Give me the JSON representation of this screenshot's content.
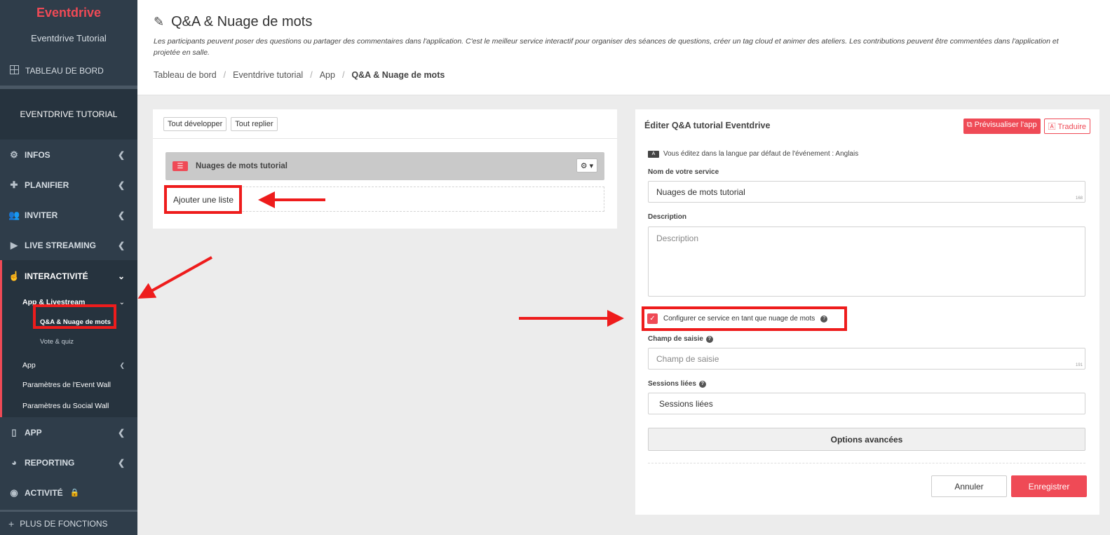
{
  "sidebar": {
    "brand": "Eventdrive",
    "event_name": "Eventdrive Tutorial",
    "dashboard": "TABLEAU DE BORD",
    "sub_brand": "EVENTDRIVE TUTORIAL",
    "items": [
      {
        "label": "INFOS",
        "icon": "gears-icon"
      },
      {
        "label": "PLANIFIER",
        "icon": "puzzle-icon"
      },
      {
        "label": "INVITER",
        "icon": "users-icon"
      },
      {
        "label": "LIVE STREAMING",
        "icon": "play-icon"
      }
    ],
    "interactivity": {
      "label": "INTERACTIVITÉ",
      "app_livestream": "App & Livestream",
      "qa": "Q&A & Nuage de mots",
      "vote": "Vote & quiz",
      "app": "App",
      "event_wall": "Paramètres de l'Event Wall",
      "social_wall": "Paramètres du Social Wall"
    },
    "bottom_items": [
      {
        "label": "APP",
        "icon": "mobile-icon"
      },
      {
        "label": "REPORTING",
        "icon": "pie-chart-icon"
      },
      {
        "label": "ACTIVITÉ",
        "icon": "eye-icon"
      }
    ],
    "more": "PLUS DE FONCTIONS"
  },
  "header": {
    "title": "Q&A & Nuage de mots",
    "description": "Les participants peuvent poser des questions ou partager des commentaires dans l'application. C'est le meilleur service interactif pour organiser des séances de questions, créer un tag cloud et animer des ateliers. Les contributions peuvent être commentées dans l'application et projetée en salle.",
    "breadcrumb": [
      "Tableau de bord",
      "Eventdrive tutorial",
      "App",
      "Q&A & Nuage de mots"
    ]
  },
  "left_panel": {
    "expand_all": "Tout développer",
    "collapse_all": "Tout replier",
    "list_title": "Nuages de mots tutorial",
    "add_list": "Ajouter une liste"
  },
  "right_panel": {
    "title": "Éditer Q&A tutorial Eventdrive",
    "preview_btn": "Prévisualiser l'app",
    "translate_btn": "Traduire",
    "lang_note": "Vous éditez dans la langue par défaut de l'événement : Anglais",
    "service_name_label": "Nom de votre service",
    "service_name_value": "Nuages de mots tutorial",
    "service_name_counter": "168",
    "description_label": "Description",
    "description_placeholder": "Description",
    "wordcloud_checkbox": "Configurer ce service en tant que nuage de mots",
    "input_field_label": "Champ de saisie",
    "input_field_placeholder": "Champ de saisie",
    "input_field_counter": "191",
    "sessions_label": "Sessions liées",
    "sessions_placeholder": "Sessions liées",
    "advanced_btn": "Options avancées",
    "cancel_btn": "Annuler",
    "save_btn": "Enregistrer"
  },
  "colors": {
    "accent": "#ef4a56",
    "sidebar_bg": "#2f3d4a",
    "annotation": "#ee1c1c"
  }
}
